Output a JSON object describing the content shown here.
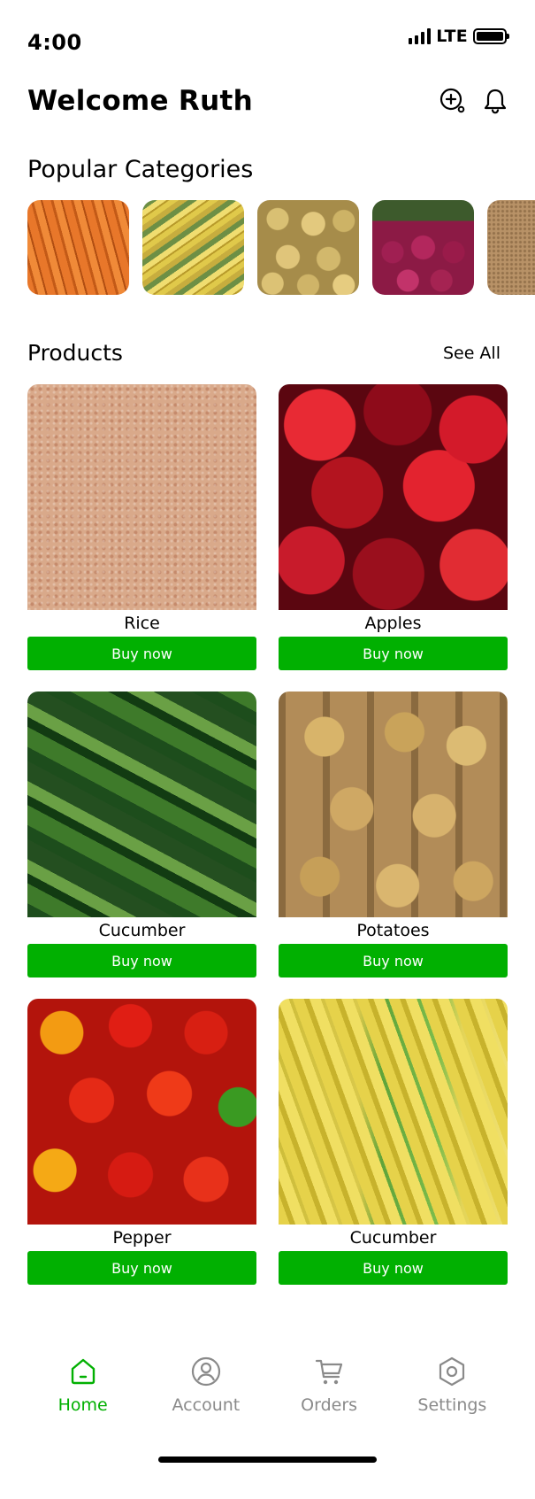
{
  "status_bar": {
    "time": "4:00",
    "network": "LTE"
  },
  "header": {
    "title": "Welcome Ruth",
    "icons": [
      "add-search-icon",
      "bell-icon"
    ]
  },
  "categories": {
    "title": "Popular Categories",
    "items": [
      "carrots",
      "corn",
      "potatoes",
      "onions",
      "grain"
    ]
  },
  "products": {
    "title": "Products",
    "see_all": "See All",
    "buy_label": "Buy now",
    "items": [
      {
        "name": "Rice"
      },
      {
        "name": "Apples"
      },
      {
        "name": "Cucumber"
      },
      {
        "name": "Potatoes"
      },
      {
        "name": "Pepper"
      },
      {
        "name": "Cucumber"
      }
    ]
  },
  "bottom_nav": {
    "active": "Home",
    "items": [
      {
        "label": "Home",
        "icon": "home-icon"
      },
      {
        "label": "Account",
        "icon": "account-icon"
      },
      {
        "label": "Orders",
        "icon": "cart-icon"
      },
      {
        "label": "Settings",
        "icon": "settings-icon"
      }
    ]
  },
  "colors": {
    "accent": "#01b001",
    "inactive": "#8a8a8a",
    "text": "#000000"
  }
}
